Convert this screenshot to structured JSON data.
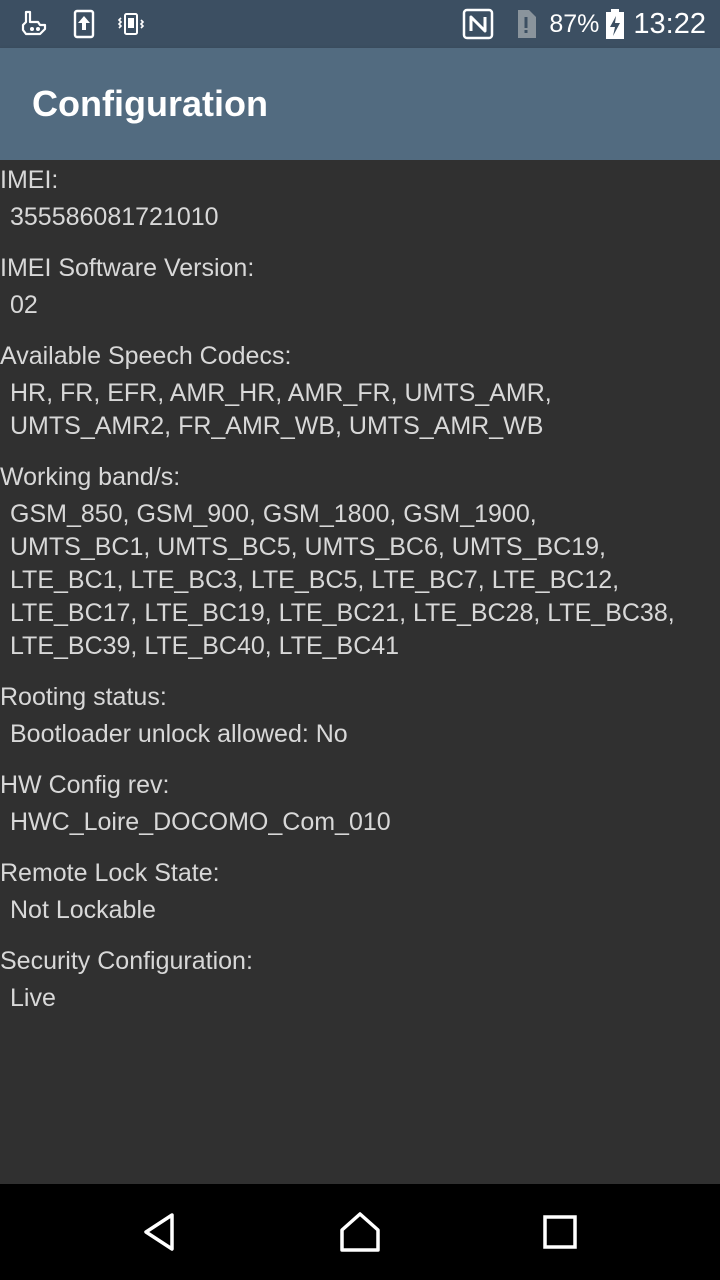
{
  "status_bar": {
    "left_icons": [
      "usb-debugging-icon",
      "upload-icon",
      "vibrate-icon"
    ],
    "right_icons": [
      "nfc-icon",
      "no-sim-icon",
      "battery-charging-icon"
    ],
    "battery_percent": "87%",
    "time": "13:22"
  },
  "app_bar": {
    "title": "Configuration",
    "background": "#526b80"
  },
  "entries": [
    {
      "label": "IMEI:",
      "value": "355586081721010"
    },
    {
      "label": "IMEI Software Version:",
      "value": "02"
    },
    {
      "label": "Available Speech Codecs:",
      "value": "HR, FR, EFR, AMR_HR, AMR_FR, UMTS_AMR,\nUMTS_AMR2, FR_AMR_WB, UMTS_AMR_WB"
    },
    {
      "label": "Working band/s:",
      "value": "GSM_850, GSM_900, GSM_1800, GSM_1900,\nUMTS_BC1, UMTS_BC5, UMTS_BC6, UMTS_BC19,\nLTE_BC1, LTE_BC3, LTE_BC5, LTE_BC7, LTE_BC12,\nLTE_BC17, LTE_BC19, LTE_BC21, LTE_BC28, LTE_BC38,\nLTE_BC39, LTE_BC40, LTE_BC41"
    },
    {
      "label": "Rooting status:",
      "value": "Bootloader unlock allowed: No"
    },
    {
      "label": "HW Config rev:",
      "value": "HWC_Loire_DOCOMO_Com_010"
    },
    {
      "label": "Remote Lock State:",
      "value": "Not Lockable"
    },
    {
      "label": "Security Configuration:",
      "value": "Live"
    }
  ],
  "nav_bar": {
    "buttons": [
      "back-icon",
      "home-icon",
      "recents-icon"
    ]
  }
}
